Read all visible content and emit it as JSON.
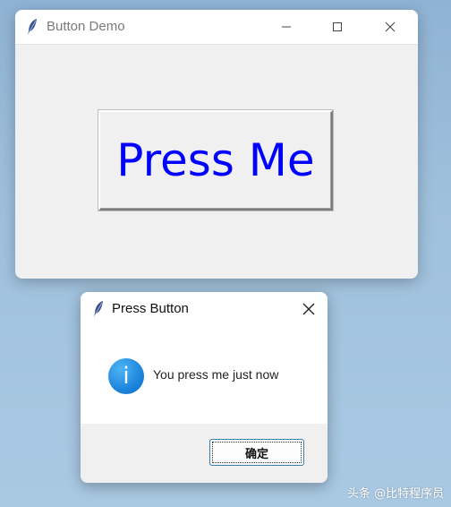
{
  "main_window": {
    "title": "Button Demo",
    "app_icon": "feather-icon",
    "controls": [
      "minimize-icon",
      "maximize-icon",
      "close-icon"
    ],
    "button_label": "Press Me",
    "button_text_color": "#0000ff"
  },
  "dialog": {
    "title": "Press Button",
    "app_icon": "feather-icon",
    "close_icon": "close-icon",
    "info_icon": "info-icon",
    "info_glyph": "i",
    "message": "You press me just now",
    "ok_label": "确定"
  },
  "watermark": "头条 @比特程序员"
}
